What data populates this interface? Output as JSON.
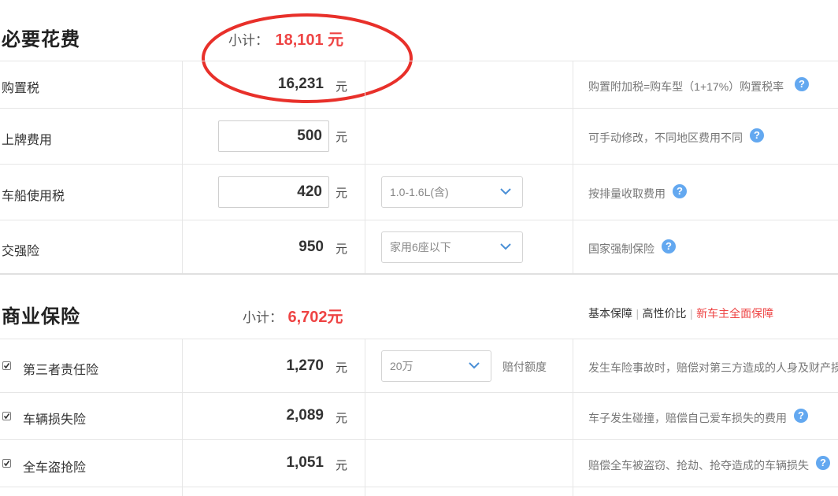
{
  "required": {
    "title": "必要花费",
    "subtotal_label": "小计：",
    "subtotal_value": "18,101 元",
    "rows": [
      {
        "label": "购置税",
        "amount": "16,231",
        "unit": "元",
        "note": "购置附加税=购车型（1+17%）购置税率"
      },
      {
        "label": "上牌费用",
        "amount": "500",
        "unit": "元",
        "note": "可手动修改，不同地区费用不同"
      },
      {
        "label": "车船使用税",
        "amount": "420",
        "unit": "元",
        "select": "1.0-1.6L(含)",
        "note": "按排量收取费用"
      },
      {
        "label": "交强险",
        "amount": "950",
        "unit": "元",
        "select": "家用6座以下",
        "note": "国家强制保险"
      }
    ]
  },
  "commercial": {
    "title": "商业保险",
    "subtotal_label": "小计：",
    "subtotal_value": "6,702元",
    "plans": [
      "基本保障",
      "高性价比",
      "新车主全面保障"
    ],
    "plan_separator": "|",
    "rows": [
      {
        "label": "第三者责任险",
        "amount": "1,270",
        "unit": "元",
        "checked": true,
        "select": "20万",
        "select_suffix": "赔付额度",
        "note": "发生车险事故时，赔偿对第三方造成的人身及财产损"
      },
      {
        "label": "车辆损失险",
        "amount": "2,089",
        "unit": "元",
        "checked": true,
        "note": "车子发生碰撞，赔偿自己爱车损失的费用"
      },
      {
        "label": "全车盗抢险",
        "amount": "1,051",
        "unit": "元",
        "checked": true,
        "note": "赔偿全车被盗窃、抢劫、抢夺造成的车辆损失"
      }
    ]
  },
  "help_glyph": "?",
  "colors": {
    "accent_red": "#ee4444",
    "help_blue": "#63a8f0",
    "annotation_red": "#e8302a"
  }
}
